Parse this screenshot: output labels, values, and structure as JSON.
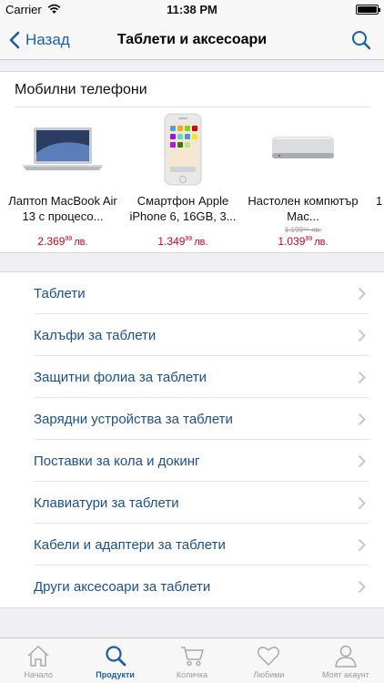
{
  "status_bar": {
    "carrier": "Carrier",
    "time": "11:38 PM"
  },
  "navbar": {
    "back_label": "Назад",
    "title": "Таблети и аксесоари"
  },
  "featured": {
    "title": "Мобилни телефони",
    "products": [
      {
        "name": "Лаптоп MacBook Air 13 с процесо...",
        "old_price": "",
        "price_int": "2.369",
        "price_dec": "99",
        "currency": "лв."
      },
      {
        "name": "Смартфон Apple iPhone 6, 16GB, 3...",
        "old_price": "",
        "price_int": "1.349",
        "price_dec": "99",
        "currency": "лв."
      },
      {
        "name": "Настолен компютър Mac...",
        "old_price": "1.199⁹⁹ лв.",
        "price_int": "1.039",
        "price_dec": "99",
        "currency": "лв."
      },
      {
        "name": "1",
        "old_price": "",
        "price_int": "",
        "price_dec": "",
        "currency": ""
      }
    ]
  },
  "categories": [
    "Таблети",
    "Калъфи за таблети",
    "Защитни фолиа за таблети",
    "Зарядни устройства за таблети",
    "Поставки за кола и докинг",
    "Клавиатури за таблети",
    "Кабели и адаптери за таблети",
    "Други аксесоари за таблети"
  ],
  "tabs": [
    {
      "label": "Начало",
      "icon": "home-icon",
      "active": false
    },
    {
      "label": "Продукти",
      "icon": "search-icon",
      "active": true
    },
    {
      "label": "Количка",
      "icon": "cart-icon",
      "active": false
    },
    {
      "label": "Любими",
      "icon": "heart-icon",
      "active": false
    },
    {
      "label": "Моят акаунт",
      "icon": "user-icon",
      "active": false
    }
  ],
  "colors": {
    "accent": "#1a5ea8",
    "price": "#d0021b",
    "category_text": "#1a4f95"
  }
}
